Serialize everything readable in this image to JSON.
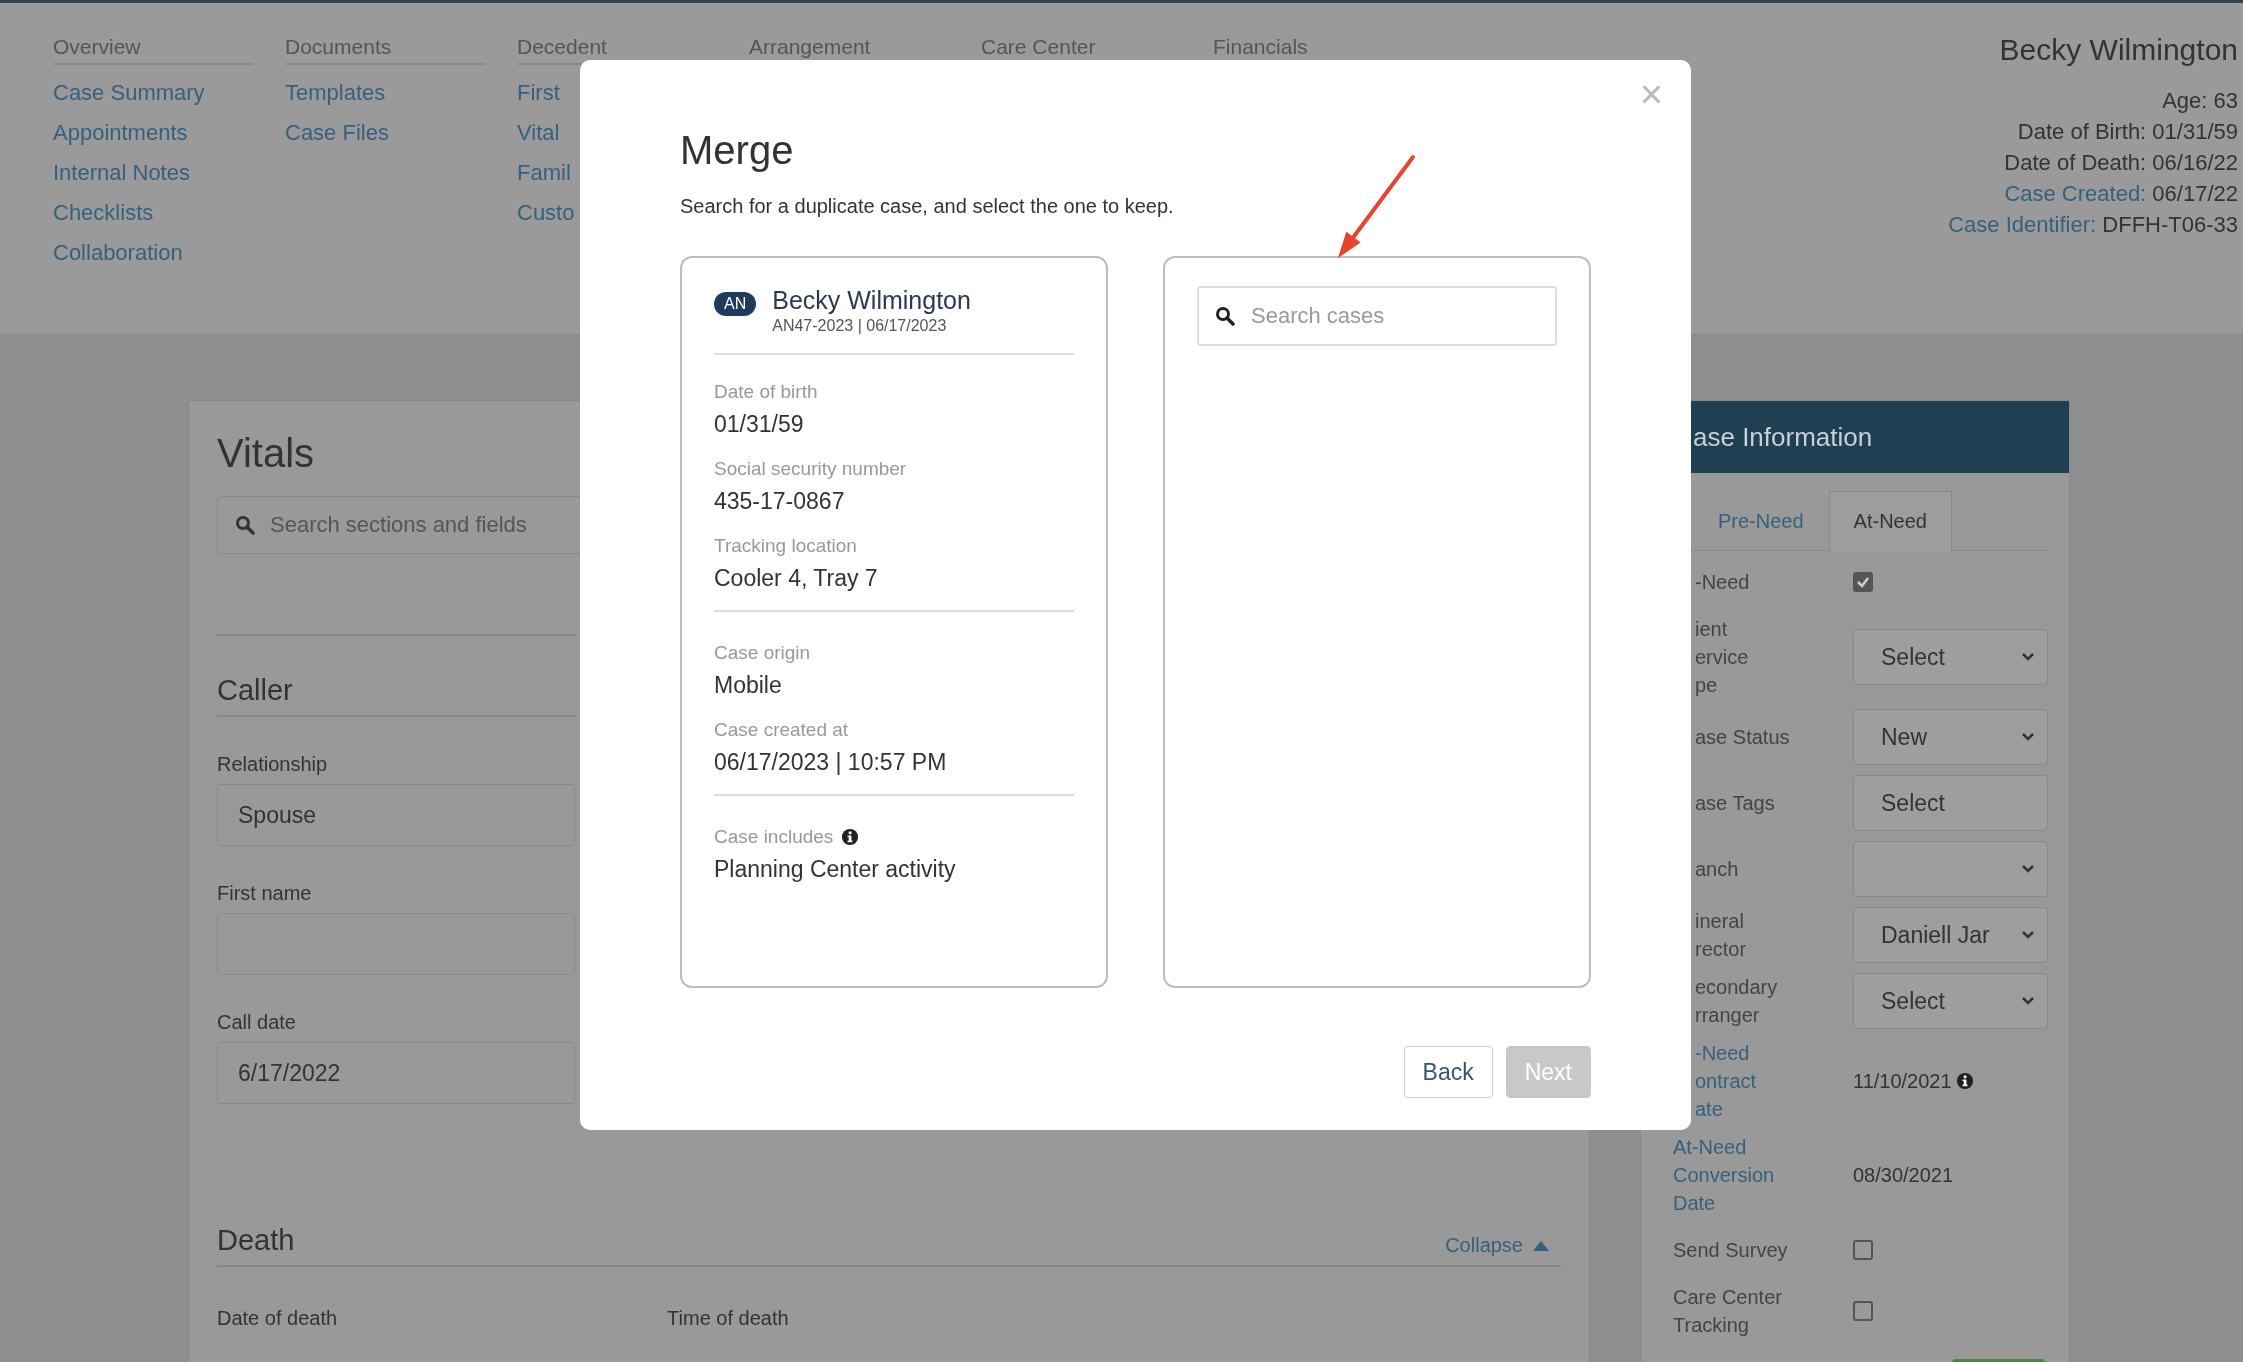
{
  "nav": {
    "columns": [
      {
        "heading": "Overview",
        "links": [
          "Case Summary",
          "Appointments",
          "Internal Notes",
          "Checklists",
          "Collaboration"
        ]
      },
      {
        "heading": "Documents",
        "links": [
          "Templates",
          "Case Files"
        ]
      },
      {
        "heading": "Decedent",
        "links": [
          "First",
          "Vital",
          "Famil",
          "Custo"
        ]
      },
      {
        "heading": "Arrangement"
      },
      {
        "heading": "Care Center"
      },
      {
        "heading": "Financials"
      }
    ]
  },
  "patient": {
    "name": "Becky Wilmington",
    "lines": [
      {
        "label": "Age:",
        "value": "63",
        "link": false
      },
      {
        "label": "Date of Birth:",
        "value": "01/31/59",
        "link": false
      },
      {
        "label": "Date of Death:",
        "value": "06/16/22",
        "link": false
      },
      {
        "label": "Case Created:",
        "value": "06/17/22",
        "link": true
      },
      {
        "label": "Case Identifier:",
        "value": "DFFH-T06-33",
        "link": true
      }
    ]
  },
  "vitals": {
    "title": "Vitals",
    "search": {
      "placeholder": "Search sections and fields"
    },
    "caller": {
      "heading": "Caller",
      "fields": [
        {
          "label": "Relationship",
          "value": "Spouse"
        },
        {
          "label": "First name"
        },
        {
          "label": "Call date",
          "value": "6/17/2022"
        }
      ]
    },
    "death": {
      "heading": "Death",
      "toggle": "Collapse",
      "fields": [
        "Date of death",
        "Time of death"
      ]
    }
  },
  "case_info": {
    "title": "ase Information",
    "tabs": [
      {
        "label": "Pre-Need",
        "selected": false
      },
      {
        "label": "At-Need",
        "selected": true
      }
    ],
    "rows": [
      {
        "label": "-Need",
        "kind": "checkbox",
        "checked": true,
        "clipped": true,
        "link": false
      },
      {
        "label": "ient\nervice\npe",
        "kind": "select",
        "value": "Select",
        "clipped": true,
        "link": false
      },
      {
        "label": "ase Status",
        "kind": "select",
        "value": "New",
        "clipped": true,
        "link": false
      },
      {
        "label": "ase Tags",
        "kind": "multiselect",
        "value": "Select",
        "clipped": true,
        "link": false
      },
      {
        "label": "anch",
        "kind": "select",
        "clipped": true,
        "link": false
      },
      {
        "label": "ineral\nrector",
        "kind": "select",
        "value": "Daniell Jar",
        "clipped": true,
        "link": false
      },
      {
        "label": "econdary\nrranger",
        "kind": "select",
        "value": "Select",
        "clipped": true,
        "link": false
      },
      {
        "label": "-Need\nontract\nate",
        "kind": "date",
        "value": "11/10/2021",
        "info": true,
        "clipped": true,
        "link": true
      },
      {
        "label": "At-Need\nConversion\nDate",
        "kind": "date",
        "value": "08/30/2021",
        "info": false,
        "clipped": false,
        "link": true
      },
      {
        "label": "Send Survey",
        "kind": "checkbox",
        "checked": false,
        "clipped": false,
        "link": false
      },
      {
        "label": "Care Center\nTracking",
        "kind": "checkbox",
        "checked": false,
        "clipped": false,
        "link": false
      }
    ]
  },
  "modal": {
    "close": "×",
    "title": "Merge",
    "subtitle": "Search for a duplicate case, and select the one to keep.",
    "case": {
      "badge": "AN",
      "name": "Becky Wilmington",
      "meta": "AN47-2023 | 06/17/2023",
      "groups": [
        [
          {
            "label": "Date of birth",
            "value": "01/31/59",
            "info": false
          },
          {
            "label": "Social security number",
            "value": "435-17-0867",
            "info": false
          },
          {
            "label": "Tracking location",
            "value": "Cooler 4, Tray 7",
            "info": false
          }
        ],
        [
          {
            "label": "Case origin",
            "value": "Mobile",
            "info": false
          },
          {
            "label": "Case created at",
            "value": "06/17/2023 | 10:57 PM",
            "info": false
          }
        ],
        [
          {
            "label": "Case includes",
            "value": "Planning Center activity",
            "info": true
          }
        ]
      ]
    },
    "search": {
      "placeholder": "Search cases"
    },
    "buttons": [
      {
        "label": "Back",
        "disabled": false
      },
      {
        "label": "Next",
        "disabled": true
      }
    ]
  }
}
